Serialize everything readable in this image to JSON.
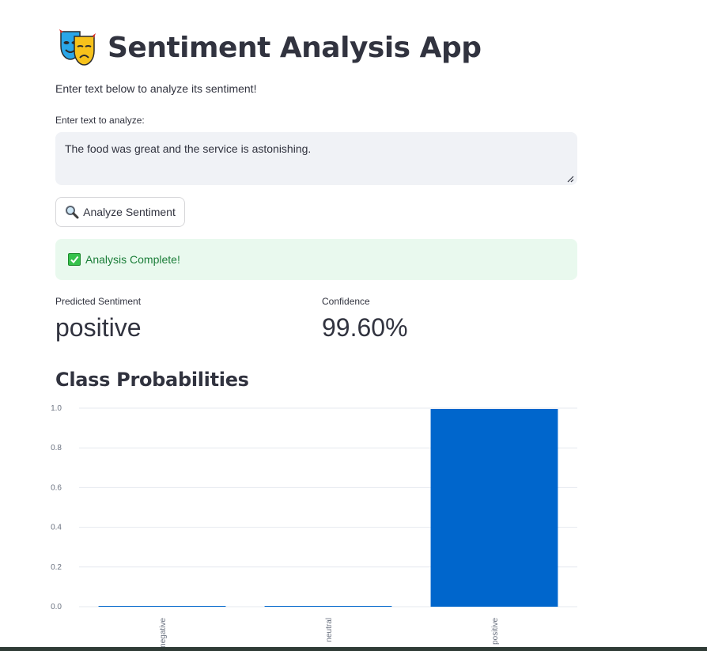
{
  "app": {
    "title": "Sentiment Analysis App",
    "title_icon": "theater-masks-icon",
    "subtitle": "Enter text below to analyze its sentiment!"
  },
  "input": {
    "label": "Enter text to analyze:",
    "value": "The food was great and the service is astonishing."
  },
  "analyze_button": {
    "icon": "magnifier-icon",
    "label": "Analyze Sentiment"
  },
  "status": {
    "icon": "check-mark-icon",
    "message": "Analysis Complete!"
  },
  "metrics": {
    "sentiment": {
      "label": "Predicted Sentiment",
      "value": "positive"
    },
    "confidence": {
      "label": "Confidence",
      "value": "99.60%"
    }
  },
  "section": {
    "title": "Class Probabilities"
  },
  "colors": {
    "bar": "#0066cc",
    "text": "#31333f",
    "success_bg": "#e9f9ee",
    "success_text": "#1a7d38",
    "input_bg": "#f0f2f6"
  },
  "chart_data": {
    "type": "bar",
    "categories": [
      "negative",
      "neutral",
      "positive"
    ],
    "values": [
      0.002,
      0.002,
      0.996
    ],
    "ylim": [
      0,
      1.0
    ],
    "yticks": [
      "0.0",
      "0.2",
      "0.4",
      "0.6",
      "0.8",
      "1.0"
    ],
    "grid": true,
    "xlabel": "",
    "ylabel": ""
  }
}
